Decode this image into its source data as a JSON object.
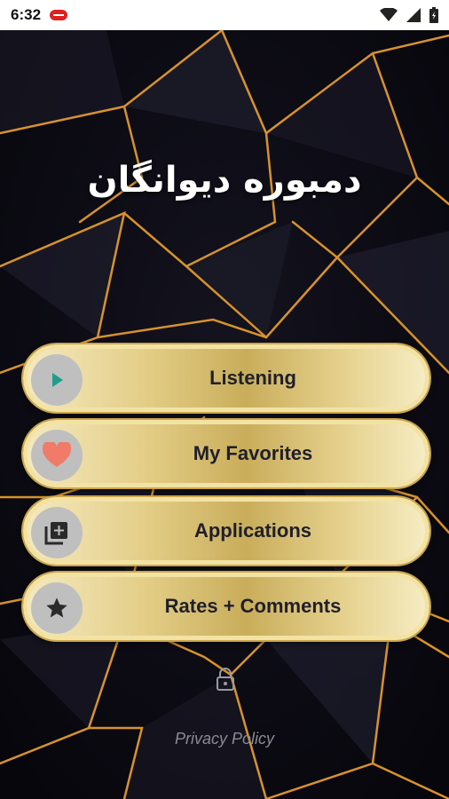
{
  "status_bar": {
    "time": "6:32"
  },
  "app": {
    "title": "دمبوره دیوانگان"
  },
  "menu": [
    {
      "label": "Listening",
      "icon": "play-icon"
    },
    {
      "label": "My Favorites",
      "icon": "heart-icon"
    },
    {
      "label": "Applications",
      "icon": "library-add-icon"
    },
    {
      "label": "Rates + Comments",
      "icon": "star-icon"
    }
  ],
  "footer": {
    "privacy_label": "Privacy Policy"
  },
  "colors": {
    "play": "#1f9d8a",
    "heart": "#f07b68",
    "icon_dark": "#2a2a2a",
    "gold": "#d8b55a"
  }
}
